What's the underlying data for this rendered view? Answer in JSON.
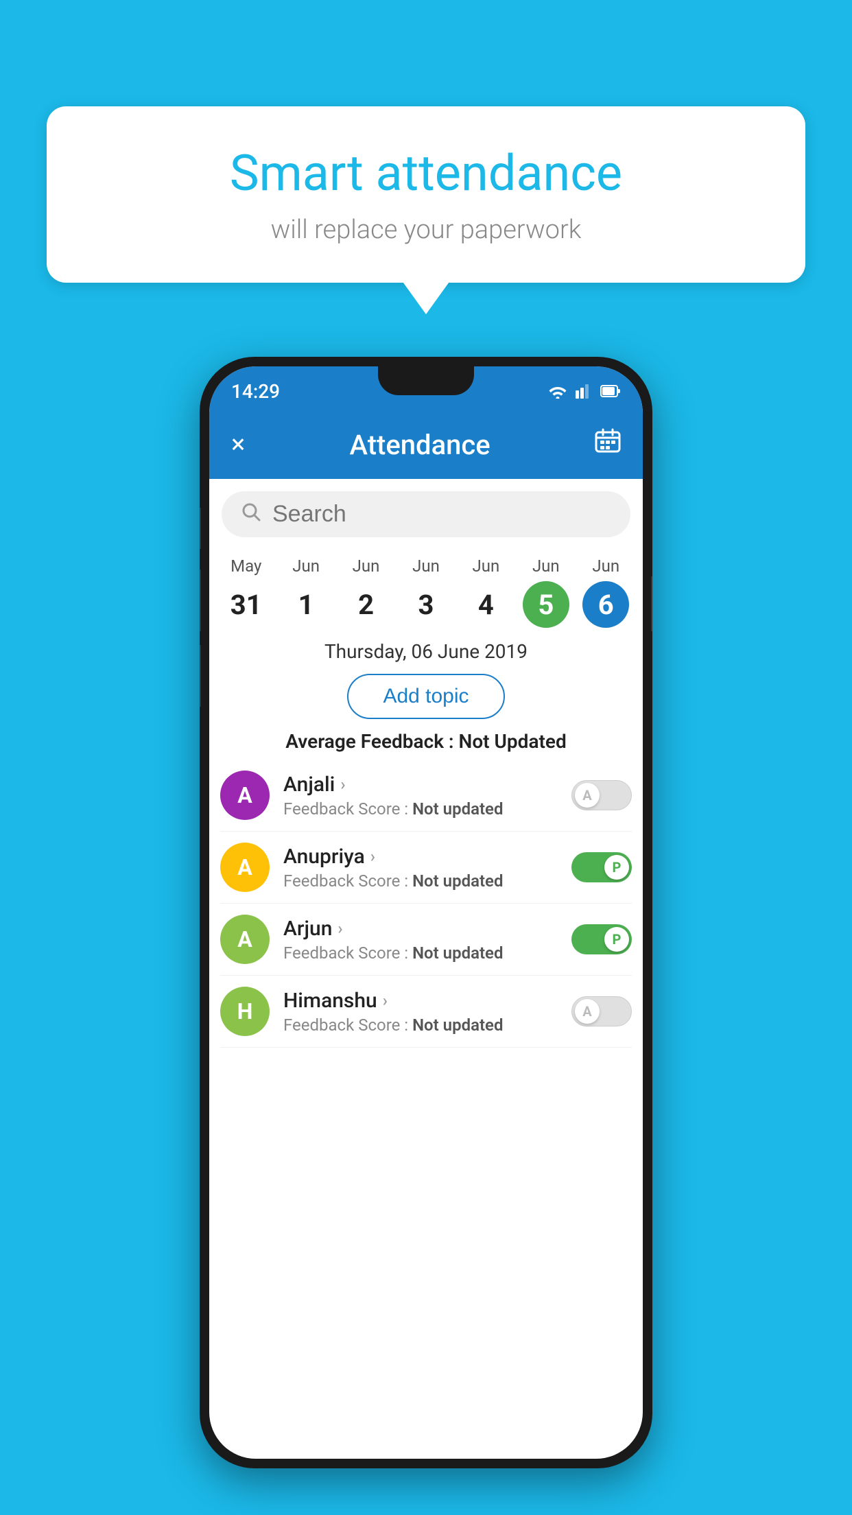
{
  "background_color": "#1BB8E8",
  "speech_bubble": {
    "title": "Smart attendance",
    "subtitle": "will replace your paperwork"
  },
  "phone": {
    "status_bar": {
      "time": "14:29"
    },
    "app_bar": {
      "title": "Attendance",
      "close_label": "×",
      "calendar_icon": "calendar"
    },
    "search": {
      "placeholder": "Search"
    },
    "calendar": {
      "days": [
        {
          "month": "May",
          "date": "31",
          "state": "normal"
        },
        {
          "month": "Jun",
          "date": "1",
          "state": "normal"
        },
        {
          "month": "Jun",
          "date": "2",
          "state": "normal"
        },
        {
          "month": "Jun",
          "date": "3",
          "state": "normal"
        },
        {
          "month": "Jun",
          "date": "4",
          "state": "normal"
        },
        {
          "month": "Jun",
          "date": "5",
          "state": "today"
        },
        {
          "month": "Jun",
          "date": "6",
          "state": "selected"
        }
      ]
    },
    "selected_date": "Thursday, 06 June 2019",
    "add_topic_label": "Add topic",
    "avg_feedback_label": "Average Feedback :",
    "avg_feedback_value": "Not Updated",
    "students": [
      {
        "name": "Anjali",
        "avatar_letter": "A",
        "avatar_color": "#9C27B0",
        "feedback_label": "Feedback Score :",
        "feedback_value": "Not updated",
        "attendance": "absent",
        "toggle_label": "A"
      },
      {
        "name": "Anupriya",
        "avatar_letter": "A",
        "avatar_color": "#FFC107",
        "feedback_label": "Feedback Score :",
        "feedback_value": "Not updated",
        "attendance": "present",
        "toggle_label": "P"
      },
      {
        "name": "Arjun",
        "avatar_letter": "A",
        "avatar_color": "#8BC34A",
        "feedback_label": "Feedback Score :",
        "feedback_value": "Not updated",
        "attendance": "present",
        "toggle_label": "P"
      },
      {
        "name": "Himanshu",
        "avatar_letter": "H",
        "avatar_color": "#8BC34A",
        "feedback_label": "Feedback Score :",
        "feedback_value": "Not updated",
        "attendance": "absent",
        "toggle_label": "A"
      }
    ]
  }
}
